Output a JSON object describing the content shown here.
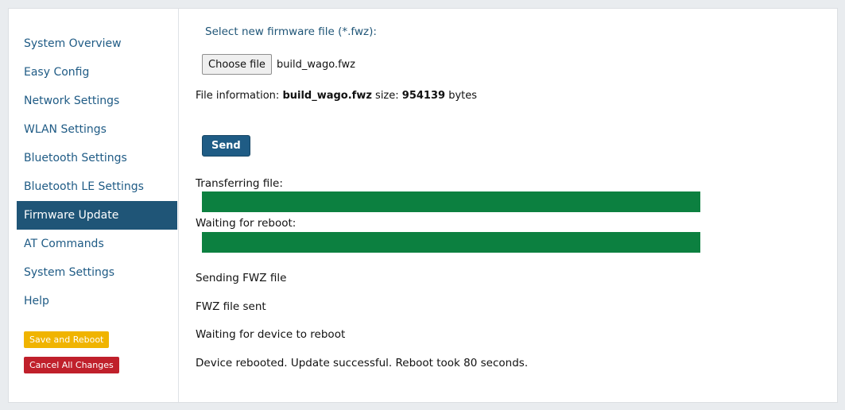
{
  "sidebar": {
    "items": [
      {
        "label": "System Overview"
      },
      {
        "label": "Easy Config"
      },
      {
        "label": "Network Settings"
      },
      {
        "label": "WLAN Settings"
      },
      {
        "label": "Bluetooth Settings"
      },
      {
        "label": "Bluetooth LE Settings"
      },
      {
        "label": "Firmware Update"
      },
      {
        "label": "AT Commands"
      },
      {
        "label": "System Settings"
      },
      {
        "label": "Help"
      }
    ],
    "active_index": 6,
    "save_label": "Save and Reboot",
    "cancel_label": "Cancel All Changes"
  },
  "firmware": {
    "select_label": "Select new firmware file (*.fwz):",
    "choose_label": "Choose file",
    "chosen_file": "build_wago.fwz",
    "info_prefix": "File information:",
    "info_filename": "build_wago.fwz",
    "info_size_label": "size:",
    "info_size": "954139",
    "info_units": "bytes",
    "send_label": "Send"
  },
  "progress": {
    "transfer_label": "Transferring file:",
    "transfer_percent": 100,
    "reboot_label": "Waiting for reboot:",
    "reboot_percent": 100
  },
  "status": [
    "Sending FWZ file",
    "FWZ file sent",
    "Waiting for device to reboot",
    "Device rebooted. Update successful. Reboot took 80 seconds."
  ],
  "colors": {
    "nav_active_bg": "#1f5577",
    "nav_text": "#1f5b85",
    "progress_fill": "#0c8040",
    "save_btn": "#f0b400",
    "cancel_btn": "#c0202b",
    "send_btn": "#1f5c85"
  }
}
